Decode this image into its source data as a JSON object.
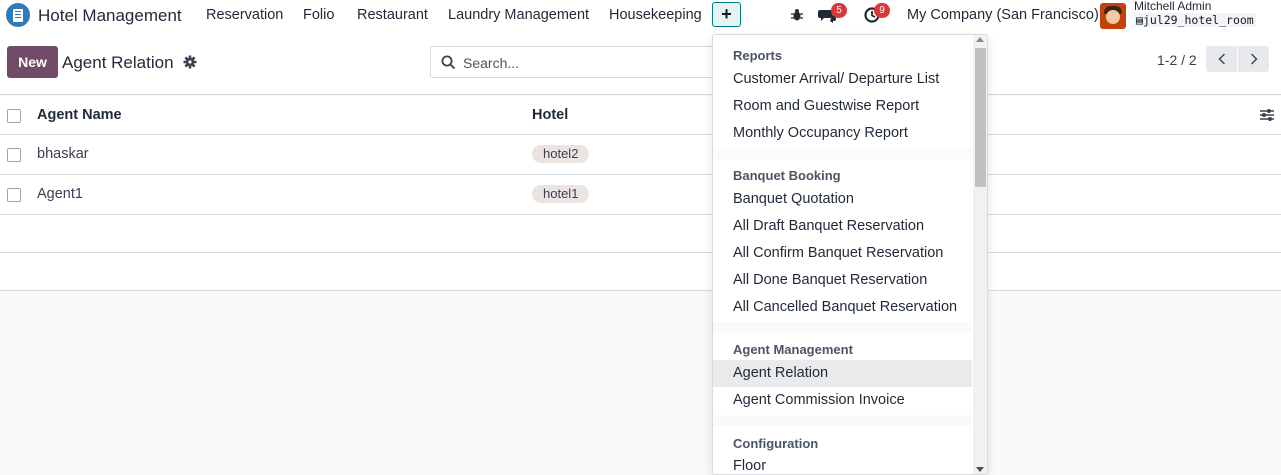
{
  "navbar": {
    "app_name": "Hotel Management",
    "menu_items": [
      "Reservation",
      "Folio",
      "Restaurant",
      "Laundry Management",
      "Housekeeping"
    ],
    "plus_label": "+",
    "messages_count": "5",
    "activities_count": "9",
    "company": "My Company (San Francisco)",
    "user_name": "Mitchell Admin",
    "database": "jul29_hotel_room"
  },
  "control_panel": {
    "new_label": "New",
    "title": "Agent Relation",
    "search_placeholder": "Search...",
    "pager": "1-2 / 2"
  },
  "list": {
    "columns": [
      "Agent Name",
      "Hotel"
    ],
    "rows": [
      {
        "agent_name": "bhaskar",
        "hotel": "hotel2"
      },
      {
        "agent_name": "Agent1",
        "hotel": "hotel1"
      }
    ]
  },
  "dropdown": {
    "sections": [
      {
        "header": "Reports",
        "items": [
          "Customer Arrival/ Departure List",
          "Room and Guestwise Report",
          "Monthly Occupancy Report"
        ]
      },
      {
        "header": "Banquet Booking",
        "items": [
          "Banquet Quotation",
          "All Draft Banquet Reservation",
          "All Confirm Banquet Reservation",
          "All Done Banquet Reservation",
          "All Cancelled Banquet Reservation"
        ]
      },
      {
        "header": "Agent Management",
        "items": [
          "Agent Relation",
          "Agent Commission Invoice"
        ]
      },
      {
        "header": "Configuration",
        "items": [
          "Floor"
        ]
      }
    ],
    "active_item": "Agent Relation"
  },
  "colors": {
    "primary": "#714b67",
    "accent": "#017e84",
    "badge": "#d9363e",
    "tag_bg": "#ece4e1"
  },
  "icons": [
    "app-icon",
    "bug-icon",
    "chat-icon",
    "clock-icon",
    "gear-icon",
    "search-icon",
    "chevron-left-icon",
    "chevron-right-icon",
    "optional-columns-icon"
  ]
}
